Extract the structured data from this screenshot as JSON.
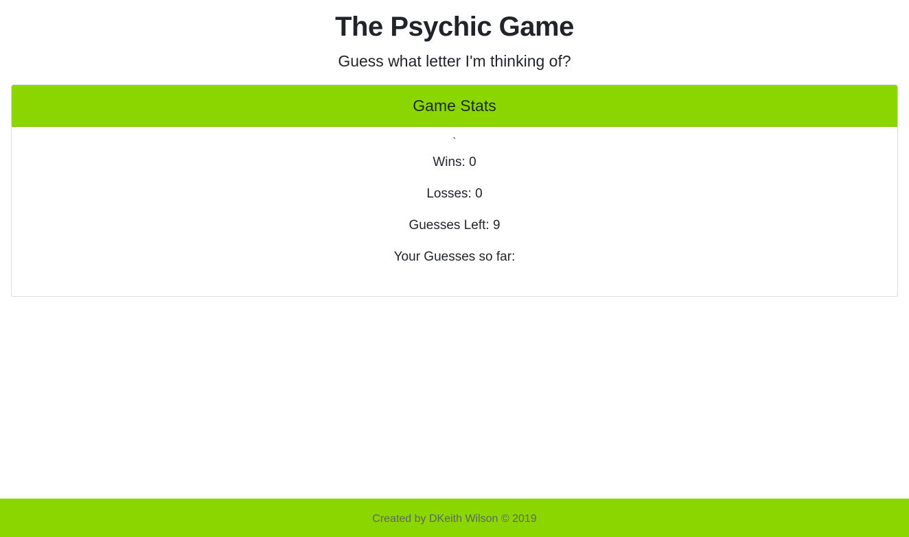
{
  "colors": {
    "accent": "#8bd600"
  },
  "header": {
    "title": "The Psychic Game",
    "subtitle": "Guess what letter I'm thinking of?"
  },
  "card": {
    "title": "Game Stats",
    "tick": "`",
    "stats": [
      "Wins: 0",
      "Losses: 0",
      "Guesses Left: 9",
      "Your Guesses so far:"
    ]
  },
  "footer": {
    "text": "Created by DKeith Wilson © 2019"
  }
}
